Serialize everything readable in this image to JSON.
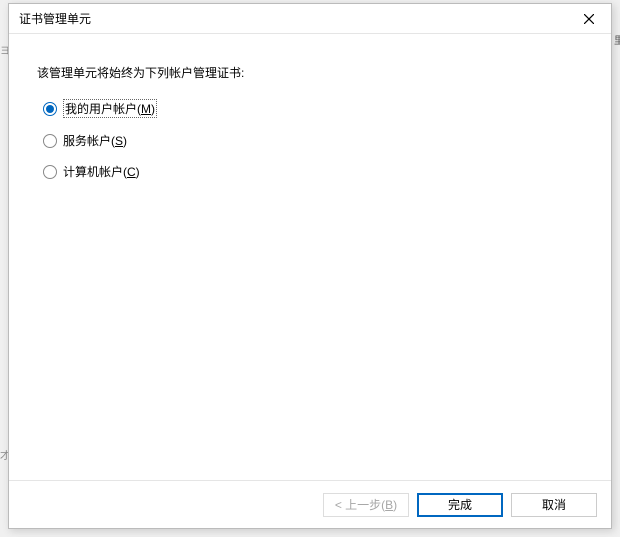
{
  "dialog": {
    "title": "证书管理单元",
    "instruction": "该管理单元将始终为下列帐户管理证书:"
  },
  "options": {
    "my_user": {
      "label_prefix": "我的用户帐户(",
      "accel": "M",
      "label_suffix": ")",
      "selected": true
    },
    "service": {
      "label_prefix": "服务帐户(",
      "accel": "S",
      "label_suffix": ")",
      "selected": false
    },
    "computer": {
      "label_prefix": "计算机帐户(",
      "accel": "C",
      "label_suffix": ")",
      "selected": false
    }
  },
  "buttons": {
    "back": {
      "prefix": "< 上一步(",
      "accel": "B",
      "suffix": ")",
      "enabled": false
    },
    "finish": {
      "label": "完成"
    },
    "cancel": {
      "label": "取消"
    }
  }
}
